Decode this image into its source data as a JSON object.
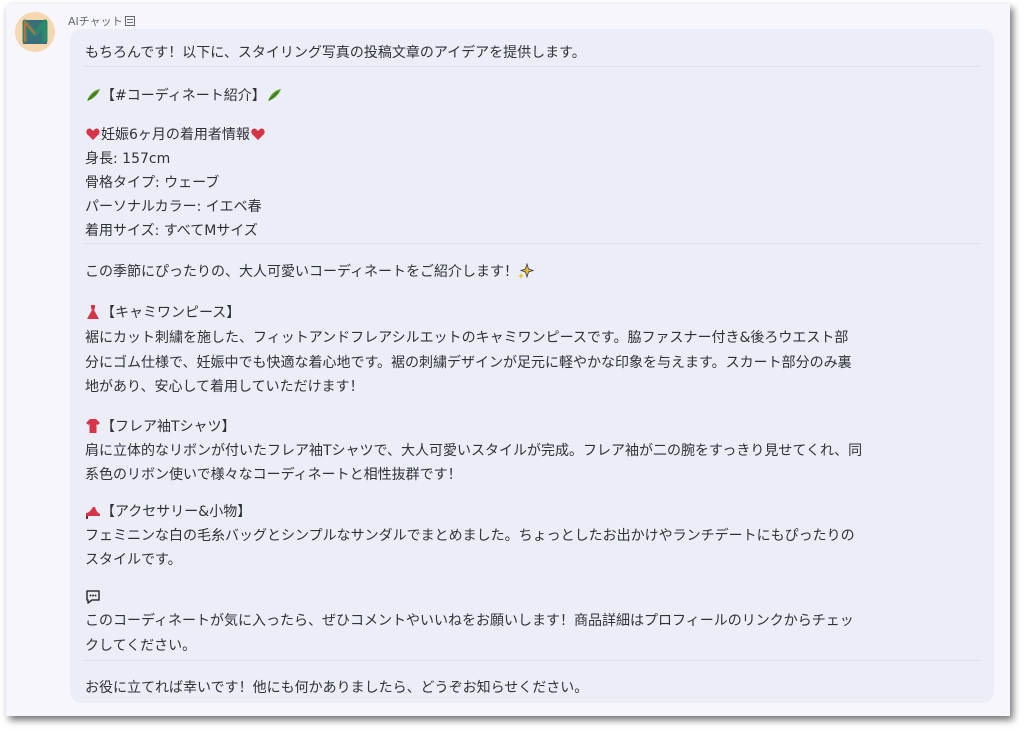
{
  "sender": {
    "name": "AIチャット"
  },
  "message": {
    "intro": "もちろんです！以下に、スタイリング写真の投稿文章のアイデアを提供します。",
    "hashtag_title": "【#コーディネート紹介】",
    "wearer": {
      "heading": "妊娠6ヶ月の着用者情報",
      "height": "身長: 157cm",
      "frame_type": "骨格タイプ: ウェーブ",
      "personal_color": "パーソナルカラー: イエベ春",
      "size": "着用サイズ: すべてMサイズ"
    },
    "lead": "この季節にぴったりの、大人可愛いコーディネートをご紹介します！",
    "item1": {
      "title": "【キャミワンピース】",
      "lines": [
        "裾にカット刺繍を施した、フィットアンドフレアシルエットのキャミワンピースです。脇ファスナー付き&後ろウエスト部",
        "分にゴム仕様で、妊娠中でも快適な着心地です。裾の刺繍デザインが足元に軽やかな印象を与えます。スカート部分のみ裏",
        "地があり、安心して着用していただけます！"
      ]
    },
    "item2": {
      "title": "【フレア袖Tシャツ】",
      "lines": [
        "肩に立体的なリボンが付いたフレア袖Tシャツで、大人可愛いスタイルが完成。フレア袖が二の腕をすっきり見せてくれ、同",
        "系色のリボン使いで様々なコーディネートと相性抜群です！"
      ]
    },
    "item3": {
      "title": "【アクセサリー&小物】",
      "lines": [
        "フェミニンな白の毛糸バッグとシンプルなサンダルでまとめました。ちょっとしたお出かけやランチデートにもぴったりの",
        "スタイルです。"
      ]
    },
    "cta_lines": [
      "このコーディネートが気に入ったら、ぜひコメントやいいねをお願いします！商品詳細はプロフィールのリンクからチェッ",
      "クしてください。"
    ],
    "closing": "お役に立てれば幸いです！他にも何かありましたら、どうぞお知らせください。"
  },
  "icons": {
    "leaf": "herb-icon",
    "heart": "heart-icon",
    "sparkle": "sparkles-icon",
    "dress": "dress-icon",
    "shirt": "shirt-icon",
    "shoe": "heel-icon",
    "comment": "speech-bubble-icon"
  },
  "colors": {
    "bubble": "#ebedf7",
    "text": "#2f3338",
    "heart": "#d63447",
    "leaf": "#5a9a2c"
  }
}
